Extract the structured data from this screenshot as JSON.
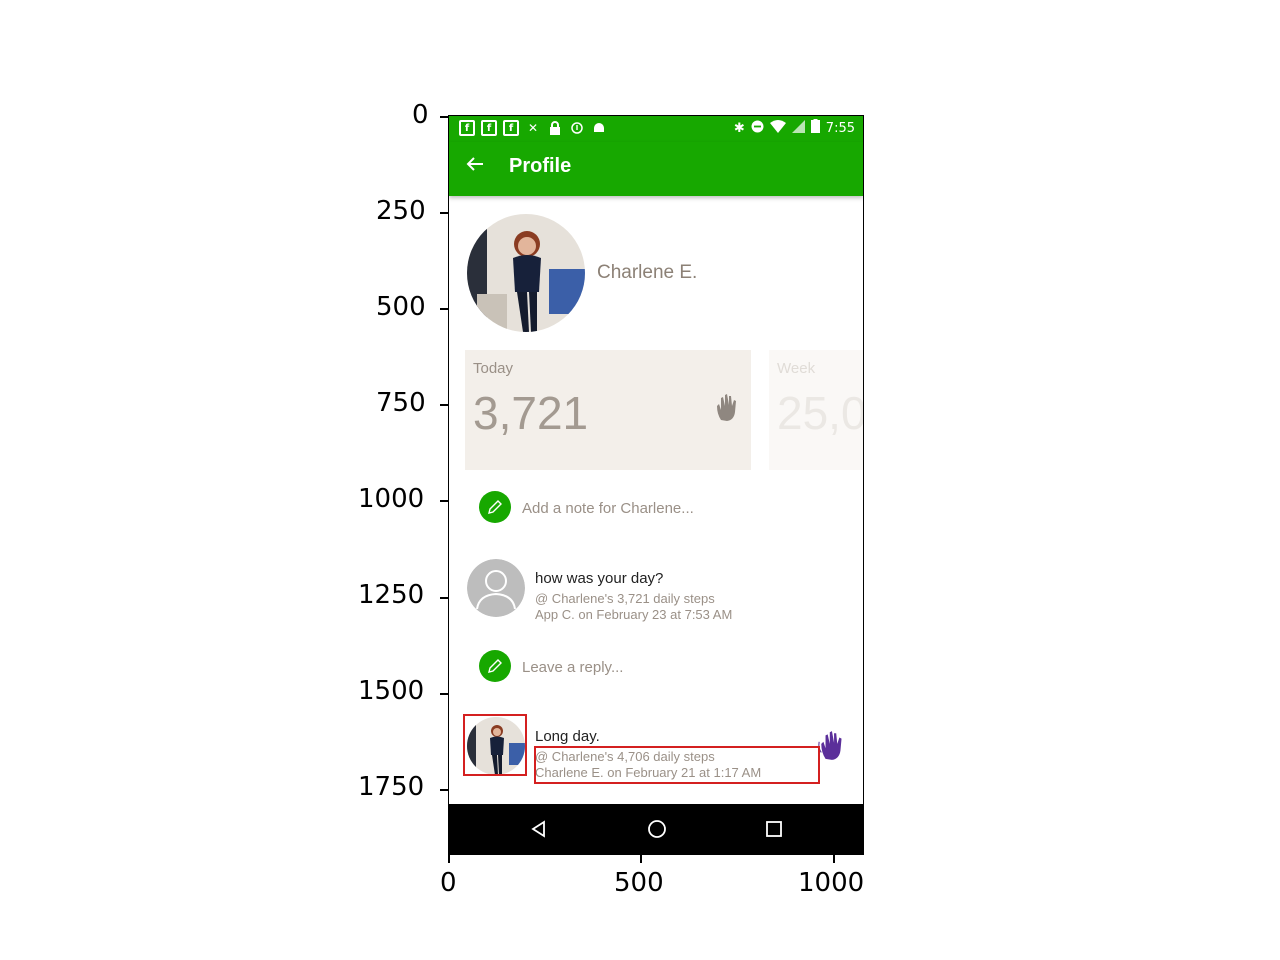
{
  "axes": {
    "y_ticks": [
      "0",
      "250",
      "500",
      "750",
      "1000",
      "1250",
      "1500",
      "1750"
    ],
    "x_ticks": [
      "0",
      "500",
      "1000"
    ]
  },
  "status_bar": {
    "time": "7:55",
    "left_icons": [
      "facebook-icon",
      "facebook-icon",
      "facebook-icon",
      "tools-icon",
      "lock-icon",
      "info-icon",
      "android-icon"
    ],
    "right_icons": [
      "bluetooth-icon",
      "do-not-disturb-icon",
      "wifi-icon",
      "no-signal-icon",
      "battery-icon"
    ]
  },
  "app_bar": {
    "title": "Profile"
  },
  "profile": {
    "name": "Charlene E."
  },
  "stats": {
    "today": {
      "label": "Today",
      "value": "3,721"
    },
    "week": {
      "label": "Week",
      "value": "25,0"
    }
  },
  "note": {
    "placeholder": "Add a note for Charlene..."
  },
  "messages": [
    {
      "title": "how was your day?",
      "line1": "@ Charlene's 3,721 daily steps",
      "line2": "App C. on February 23 at 7:53 AM"
    },
    {
      "title": "Long day.",
      "line1": "@ Charlene's 4,706 daily steps",
      "line2": "Charlene E. on February 21 at 1:17 AM"
    }
  ],
  "reply": {
    "placeholder": "Leave a reply..."
  },
  "colors": {
    "accent": "#17a800",
    "card_bg": "#f3efea",
    "muted_text": "#9a9087",
    "wave_purple": "#5b2f9a",
    "highlight": "#d42020"
  }
}
